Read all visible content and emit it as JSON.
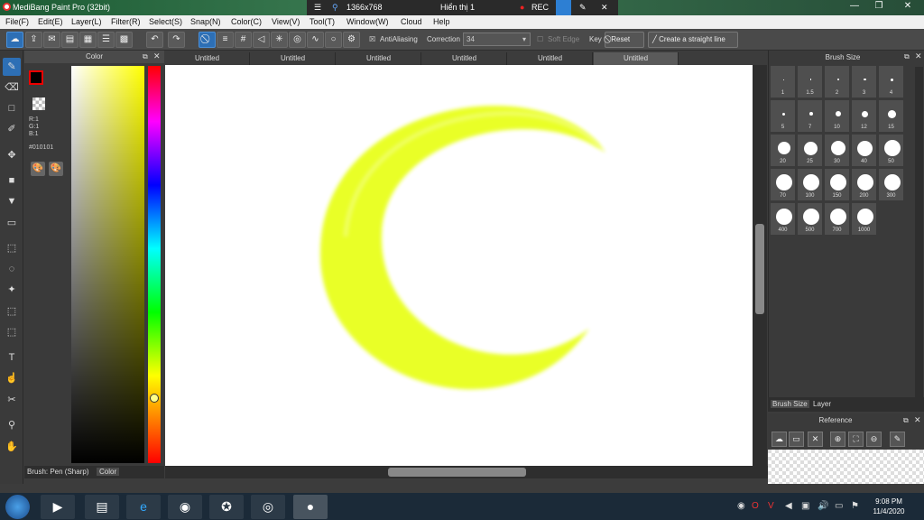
{
  "window": {
    "title": "MediBang Paint Pro (32bit)"
  },
  "recorder": {
    "resolution": "1366x768",
    "display": "Hiển thị 1",
    "rec": "REC"
  },
  "menu": [
    "File(F)",
    "Edit(E)",
    "Layer(L)",
    "Filter(R)",
    "Select(S)",
    "Snap(N)",
    "Color(C)",
    "View(V)",
    "Tool(T)",
    "Window(W)",
    "Cloud",
    "Help"
  ],
  "toolbar": {
    "antialiasing": "AntiAliasing",
    "correction_label": "Correction",
    "correction_value": "34",
    "soft_edge": "Soft Edge",
    "key": "Key",
    "reset": "Reset",
    "straight_line": "Create a straight line"
  },
  "color_panel": {
    "title": "Color",
    "r": "R:1",
    "g": "G:1",
    "b": "B:1",
    "hex": "#010101",
    "foreground": "#010101",
    "hue_marker_color": "#ffff66"
  },
  "left_footer": {
    "brush": "Brush: Pen (Sharp)",
    "color_tab": "Color"
  },
  "tabs": [
    "Untitled",
    "Untitled",
    "Untitled",
    "Untitled",
    "Untitled",
    "Untitled"
  ],
  "brush_panel": {
    "title": "Brush Size",
    "sizes": [
      "1",
      "1.5",
      "2",
      "3",
      "4",
      "5",
      "7",
      "10",
      "12",
      "15",
      "20",
      "25",
      "30",
      "40",
      "50",
      "70",
      "100",
      "150",
      "200",
      "300",
      "400",
      "500",
      "700",
      "1000"
    ],
    "tab_brush": "Brush Size",
    "tab_layer": "Layer"
  },
  "reference_panel": {
    "title": "Reference"
  },
  "canvas": {
    "stroke_color": "#e8ff1a"
  },
  "taskbar": {
    "time": "9:08 PM",
    "date": "11/4/2020"
  }
}
